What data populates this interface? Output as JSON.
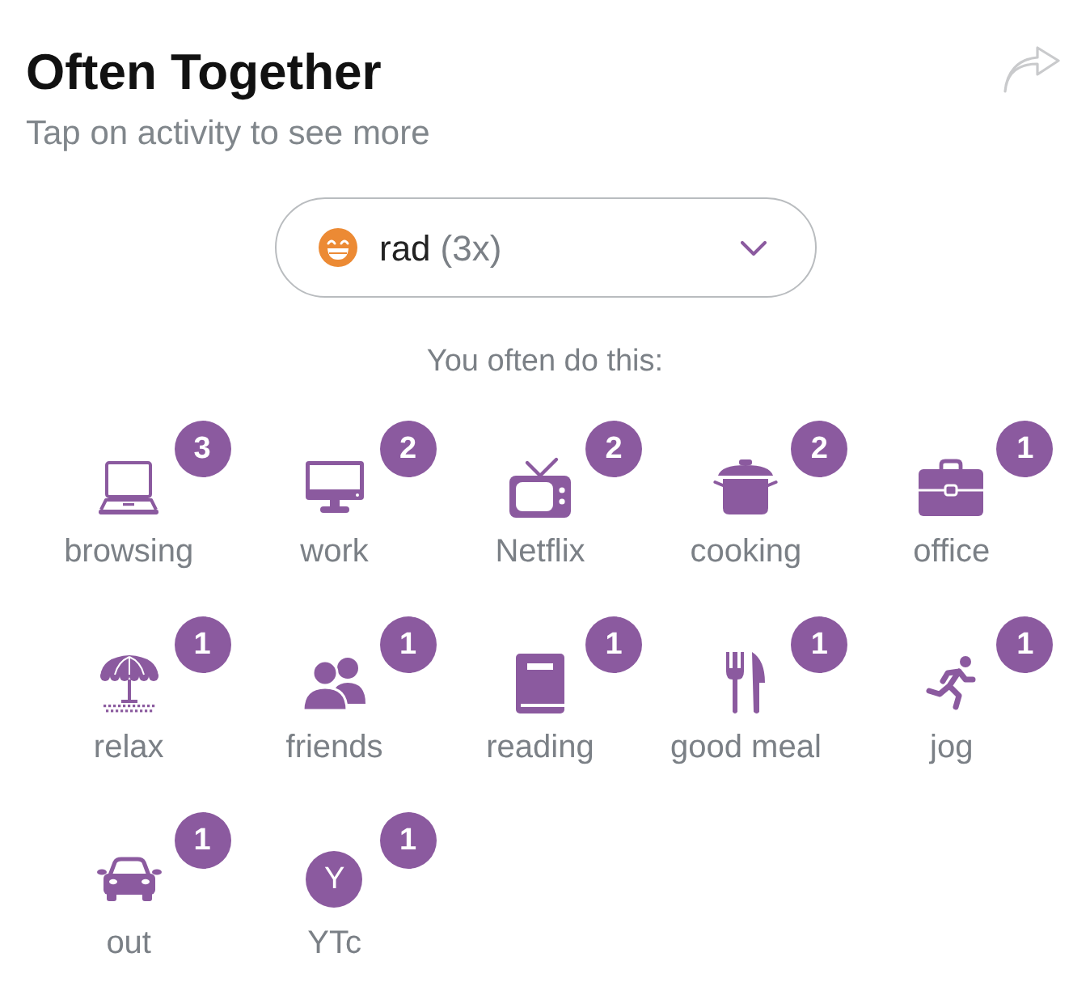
{
  "header": {
    "title": "Often Together",
    "subtitle": "Tap on activity to see more"
  },
  "mood_selector": {
    "label": "rad",
    "count": "(3x)"
  },
  "section_title": "You often do this:",
  "activities": [
    {
      "kind": "icon",
      "label": "browsing",
      "count": "3"
    },
    {
      "kind": "icon",
      "label": "work",
      "count": "2"
    },
    {
      "kind": "icon",
      "label": "Netflix",
      "count": "2"
    },
    {
      "kind": "icon",
      "label": "cooking",
      "count": "2"
    },
    {
      "kind": "icon",
      "label": "office",
      "count": "1"
    },
    {
      "kind": "icon",
      "label": "relax",
      "count": "1"
    },
    {
      "kind": "icon",
      "label": "friends",
      "count": "1"
    },
    {
      "kind": "icon",
      "label": "reading",
      "count": "1"
    },
    {
      "kind": "icon",
      "label": "good meal",
      "count": "1"
    },
    {
      "kind": "icon",
      "label": "jog",
      "count": "1"
    },
    {
      "kind": "icon",
      "label": "out",
      "count": "1"
    },
    {
      "kind": "letter",
      "initial": "Y",
      "label": "YTc",
      "count": "1"
    }
  ]
}
